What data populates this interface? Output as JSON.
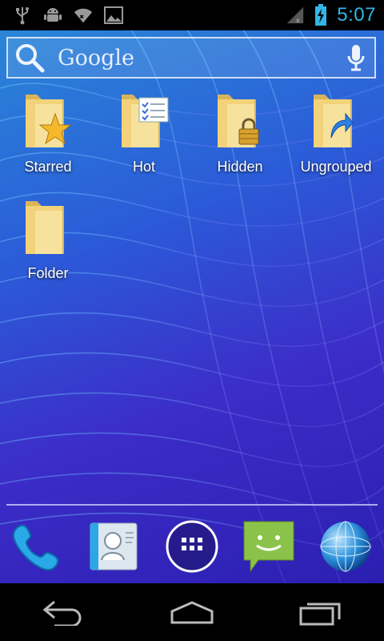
{
  "status_bar": {
    "time": "5:07",
    "left_icons": [
      "usb-icon",
      "android-debug-icon",
      "wifi-icon",
      "image-icon"
    ],
    "right_icons": [
      "signal-icon",
      "battery-icon"
    ],
    "clock_color": "#33b5e5"
  },
  "search": {
    "label": "Google",
    "icons": [
      "search-icon",
      "mic-icon"
    ]
  },
  "folders": [
    {
      "label": "Starred",
      "badge": "star-icon"
    },
    {
      "label": "Hot",
      "badge": "list-icon"
    },
    {
      "label": "Hidden",
      "badge": "lock-icon"
    },
    {
      "label": "Ungrouped",
      "badge": "arrow-icon"
    },
    {
      "label": "Folder",
      "badge": ""
    }
  ],
  "dock": {
    "items": [
      "phone-icon",
      "contacts-icon",
      "app-drawer-icon",
      "messaging-icon",
      "browser-icon"
    ]
  },
  "nav": {
    "items": [
      "back-icon",
      "home-icon",
      "recent-apps-icon"
    ]
  },
  "colors": {
    "accent": "#33b5e5",
    "folder": "#f2d27a"
  }
}
